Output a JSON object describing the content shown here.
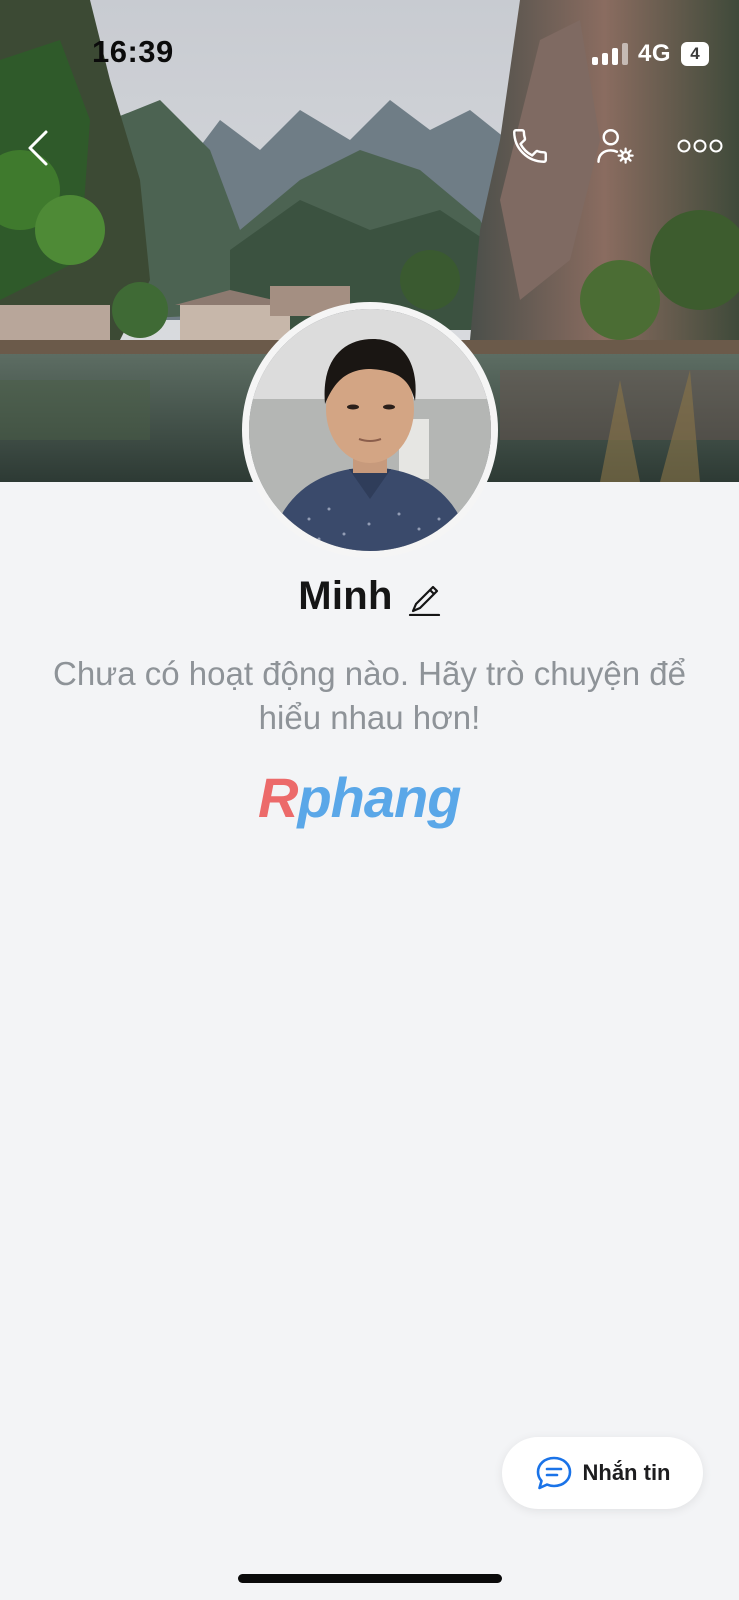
{
  "status_bar": {
    "time": "16:39",
    "network": "4G",
    "battery": "4"
  },
  "header": {
    "back_icon": "chevron-left-icon",
    "call_icon": "phone-icon",
    "settings_icon": "user-settings-icon",
    "more_icon": "more-dots-icon"
  },
  "profile": {
    "name": "Minh",
    "edit_icon": "pencil-icon",
    "empty_message": "Chưa có hoạt động nào. Hãy trò chuyện để hiểu nhau hơn!"
  },
  "watermark": {
    "first": "R",
    "rest": "phang"
  },
  "message_button": {
    "label": "Nhắn tin",
    "icon": "chat-bubble-icon"
  },
  "colors": {
    "background": "#f3f4f6",
    "accent": "#1a73e8",
    "text_primary": "#151515",
    "text_muted": "#8e9398"
  }
}
